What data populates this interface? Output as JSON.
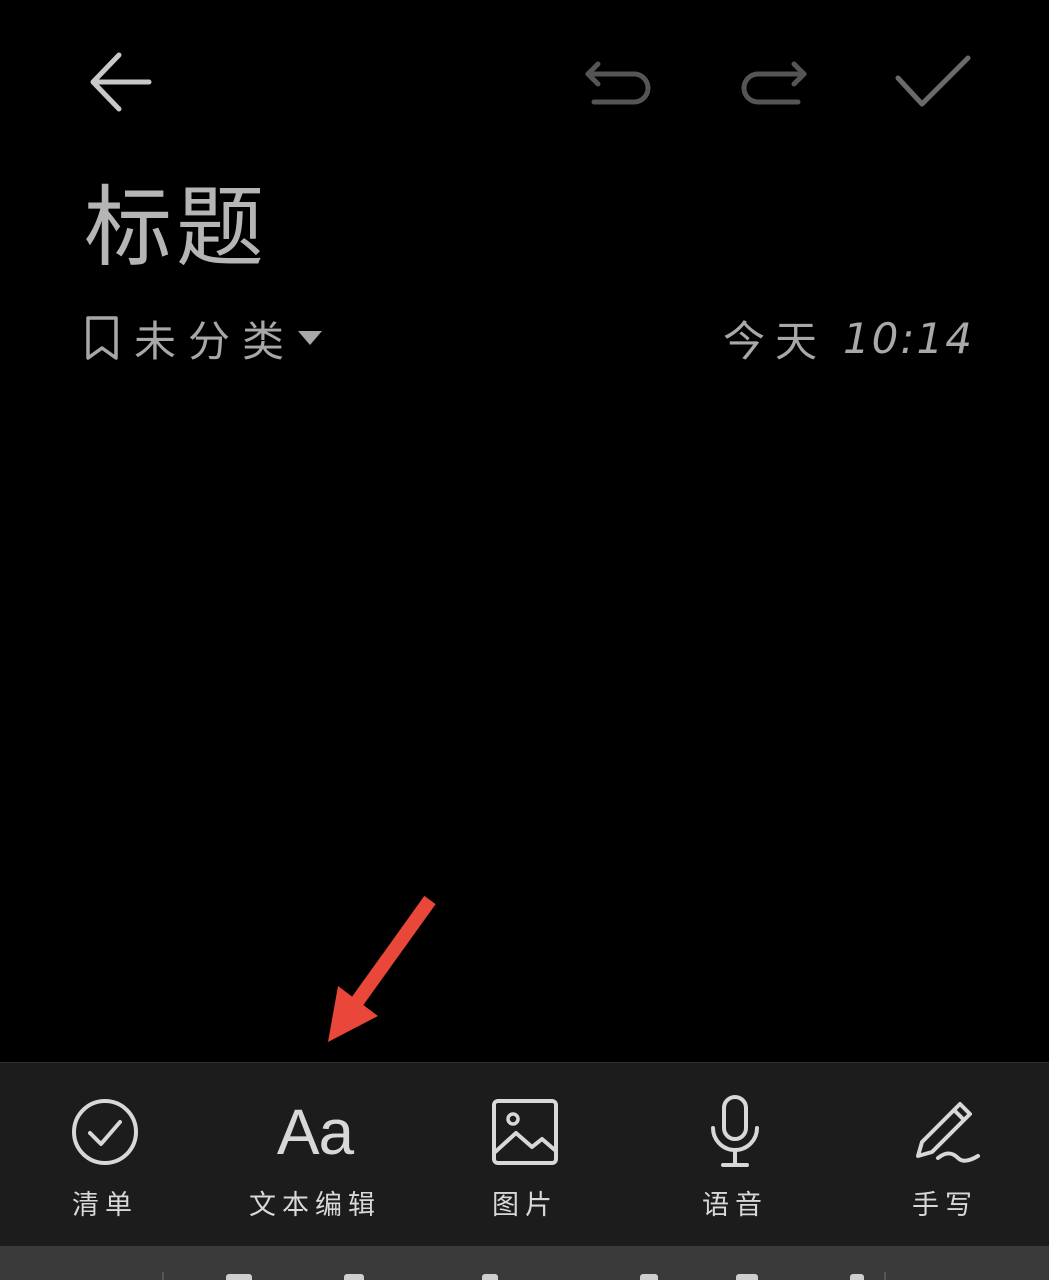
{
  "header": {
    "back_icon": "arrow-left-icon",
    "undo_icon": "undo-icon",
    "redo_icon": "redo-icon",
    "done_icon": "check-icon"
  },
  "note": {
    "title": "标题",
    "category": "未分类",
    "category_icon": "bookmark-icon",
    "day": "今天",
    "time": "10:14"
  },
  "toolbar": {
    "items": [
      {
        "label": "清单",
        "icon": "check-circle-icon"
      },
      {
        "label": "文本编辑",
        "icon": "text-format-icon",
        "glyph": "Aa"
      },
      {
        "label": "图片",
        "icon": "image-icon"
      },
      {
        "label": "语音",
        "icon": "microphone-icon"
      },
      {
        "label": "手写",
        "icon": "pen-icon"
      }
    ]
  },
  "colors": {
    "background": "#000000",
    "toolbar_bg": "#1c1c1c",
    "text": "#bdbdbd",
    "disabled_icon": "#555555",
    "annotation_arrow": "#e8473a"
  }
}
